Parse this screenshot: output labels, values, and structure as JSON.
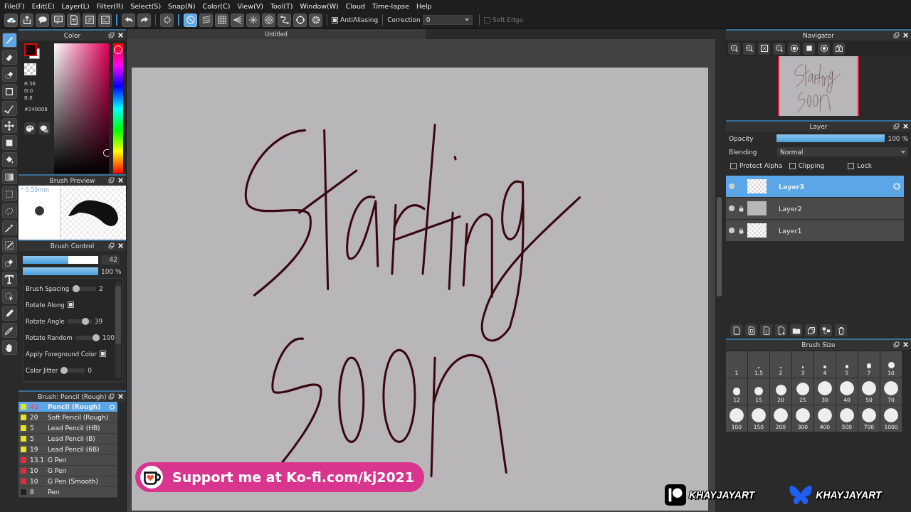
{
  "menu": [
    "File(F)",
    "Edit(E)",
    "Layer(L)",
    "Filter(R)",
    "Select(S)",
    "Snap(N)",
    "Color(C)",
    "View(V)",
    "Tool(T)",
    "Window(W)",
    "Cloud",
    "Time-lapse",
    "Help"
  ],
  "toolbar": {
    "snaps": [
      {
        "selected": true
      },
      {
        "selected": false
      },
      {
        "selected": false
      },
      {
        "selected": false
      },
      {
        "selected": false
      },
      {
        "selected": false
      },
      {
        "selected": false
      },
      {
        "selected": false
      },
      {
        "selected": false
      }
    ],
    "antialiasing": {
      "label": "AntiAliasing",
      "checked": true
    },
    "correction": {
      "label": "Correction",
      "value": "0"
    },
    "soft_edge": {
      "label": "Soft Edge",
      "checked": false,
      "disabled": true
    }
  },
  "tools": [
    {
      "selected": true
    },
    {
      "selected": false
    },
    {
      "selected": false
    },
    {
      "selected": false
    },
    {
      "selected": false
    },
    {
      "selected": false
    },
    {
      "selected": false
    },
    {
      "selected": false
    },
    {
      "selected": false
    },
    {
      "selected": false
    },
    {
      "selected": false
    },
    {
      "selected": false
    },
    {
      "selected": false
    },
    {
      "selected": false
    },
    {
      "selected": false
    },
    {
      "selected": false
    },
    {
      "selected": false
    },
    {
      "selected": false
    },
    {
      "selected": false
    }
  ],
  "color_panel": {
    "title": "Color",
    "rgb": [
      "R:36",
      "G:0",
      "B:8"
    ],
    "hex": "#240008",
    "hue_slider": {
      "level": 0.03
    }
  },
  "brush_preview": {
    "title": "Brush Preview",
    "size": "* 0.59mm"
  },
  "brush_control": {
    "title": "Brush Control",
    "size": {
      "level": 0.6,
      "value": "42"
    },
    "opacity": {
      "level": 1,
      "value": "100 %"
    },
    "settings": [
      {
        "kind": "slider",
        "label": "Brush Spacing",
        "level": 0.05,
        "value": "2"
      },
      {
        "kind": "checkbox",
        "label": "Rotate Along",
        "checked": true
      },
      {
        "kind": "slider",
        "label": "Rotate Angle",
        "level": 0.85,
        "value": "39"
      },
      {
        "kind": "slider",
        "label": "Rotate Random",
        "level": 1,
        "value": "100"
      },
      {
        "kind": "checkbox",
        "label": "Apply Foreground Color",
        "checked": true
      },
      {
        "kind": "slider",
        "label": "Color Jitter",
        "level": 0,
        "value": "0"
      }
    ]
  },
  "brush_list": {
    "title": "Brush: Pencil (Rough)",
    "items": [
      {
        "size": "42",
        "name": "Pencil (Rough)",
        "color": "#e8e41c",
        "selected": true
      },
      {
        "size": "20",
        "name": "Soft Pencil (Rough)",
        "color": "#e8e41c",
        "selected": false
      },
      {
        "size": "5",
        "name": "Lead Pencil (HB)",
        "color": "#e8e41c",
        "selected": false
      },
      {
        "size": "5",
        "name": "Lead Pencil (B)",
        "color": "#e8e41c",
        "selected": false
      },
      {
        "size": "19",
        "name": "Lead Pencil (6B)",
        "color": "#e8e41c",
        "selected": false
      },
      {
        "size": "13.1",
        "name": "G Pen",
        "color": "#e8283c",
        "selected": false
      },
      {
        "size": "10",
        "name": "G Pen",
        "color": "#e8283c",
        "selected": false
      },
      {
        "size": "10",
        "name": "G Pen (Smooth)",
        "color": "#e8283c",
        "selected": false
      },
      {
        "size": "8",
        "name": "Pen",
        "color": "#202020",
        "selected": false
      }
    ]
  },
  "document": {
    "tab": "Untitled"
  },
  "navigator": {
    "title": "Navigator"
  },
  "layer_panel": {
    "title": "Layer",
    "opacity": {
      "label": "Opacity",
      "level": 1,
      "value": "100 %"
    },
    "blending": {
      "label": "Blending",
      "value": "Normal"
    },
    "options": [
      {
        "label": "Protect Alpha",
        "checked": false
      },
      {
        "label": "Clipping",
        "checked": false
      },
      {
        "label": "Lock",
        "checked": false
      }
    ],
    "layers": [
      {
        "name": "Layer3",
        "kind": "transparent",
        "selected": true,
        "locked": false
      },
      {
        "name": "Layer2",
        "kind": "filled",
        "selected": false,
        "locked": true
      },
      {
        "name": "Layer1",
        "kind": "transparent",
        "selected": false,
        "locked": true
      }
    ]
  },
  "brush_size": {
    "title": "Brush Size",
    "sizes": [
      "1",
      "1.5",
      "2",
      "3",
      "4",
      "5",
      "7",
      "10",
      "12",
      "15",
      "20",
      "25",
      "30",
      "40",
      "50",
      "70",
      "100",
      "150",
      "200",
      "300",
      "400",
      "500",
      "700",
      "1000"
    ]
  },
  "overlays": {
    "banner": "Support me at Ko-fi.com/kj2021",
    "social_tags": [
      {
        "kind": "patreon",
        "handle": "KHAYJAYART"
      },
      {
        "kind": "bluesky",
        "handle": "KHAYJAYART"
      }
    ]
  }
}
